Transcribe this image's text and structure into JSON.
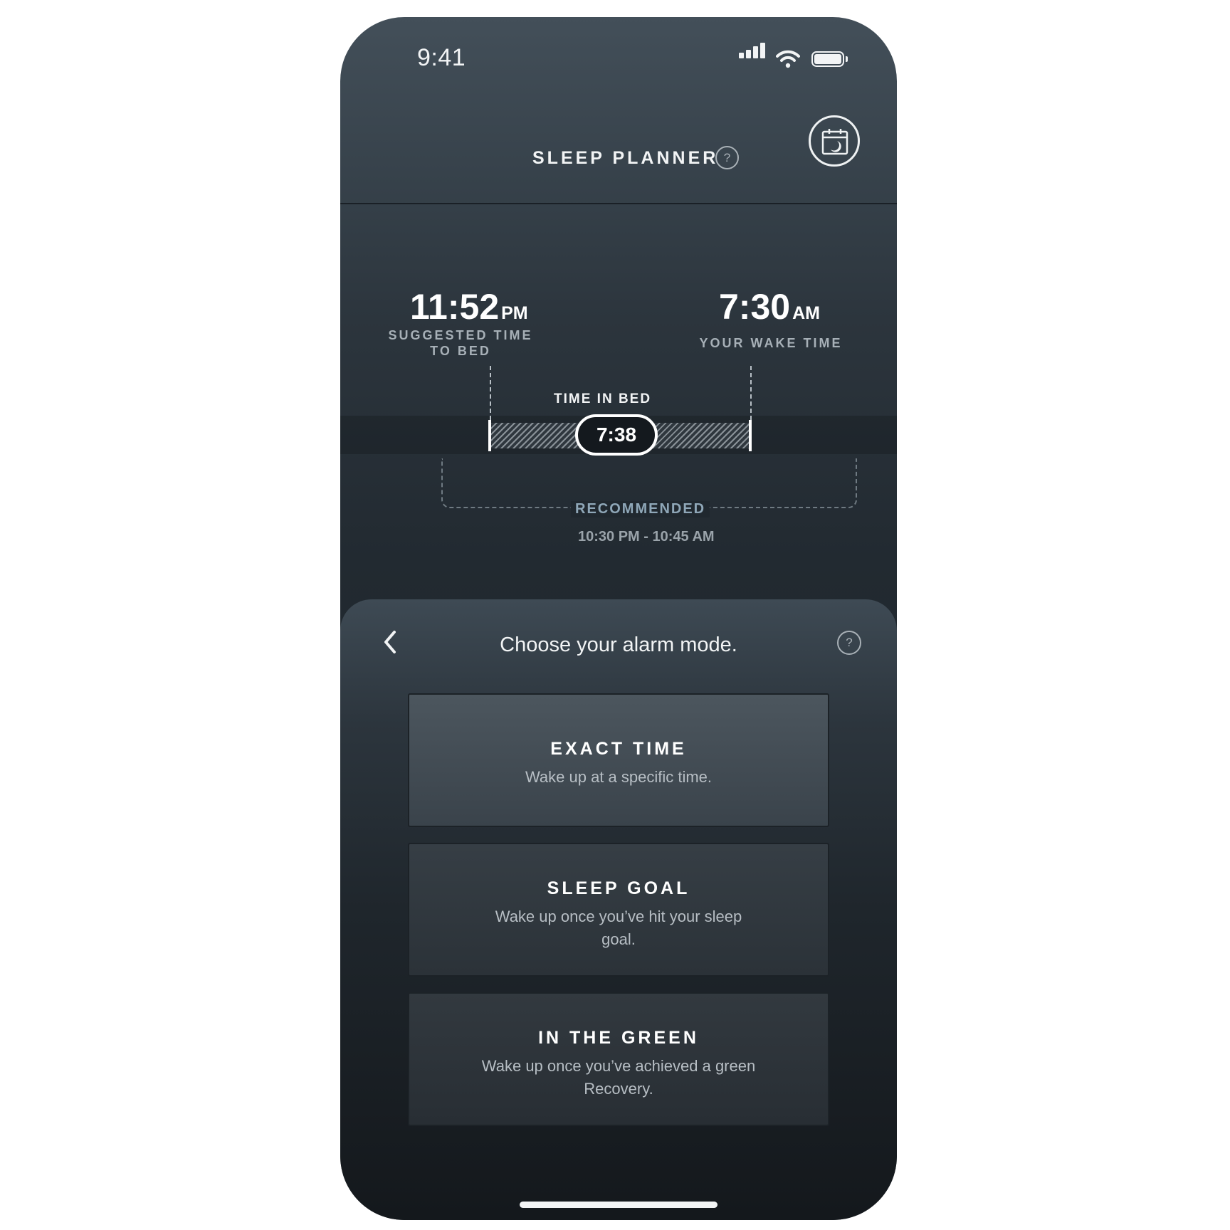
{
  "status_bar": {
    "time": "9:41"
  },
  "header": {
    "title": "SLEEP PLANNER",
    "help_glyph": "?"
  },
  "planner": {
    "bed_time": {
      "value": "11:52",
      "suffix": "PM",
      "label_line1": "SUGGESTED TIME",
      "label_line2": "TO BED"
    },
    "wake_time": {
      "value": "7:30",
      "suffix": "AM",
      "label": "YOUR WAKE TIME"
    },
    "time_in_bed": {
      "label": "TIME IN BED",
      "value": "7:38"
    },
    "recommended": {
      "label": "RECOMMENDED",
      "range": "10:30 PM - 10:45 AM"
    }
  },
  "sheet": {
    "title": "Choose your alarm mode.",
    "help_glyph": "?",
    "options": [
      {
        "title": "EXACT TIME",
        "description": "Wake up at a specific time."
      },
      {
        "title": "SLEEP GOAL",
        "description": "Wake up once you’ve hit your sleep goal."
      },
      {
        "title": "IN THE GREEN",
        "description": "Wake up once you’ve achieved a green Recovery."
      }
    ]
  },
  "icons": {
    "signal": "signal-icon",
    "wifi": "wifi-icon",
    "battery": "battery-icon",
    "calendar": "calendar-moon-icon",
    "back": "chevron-left-icon",
    "help": "question-icon"
  },
  "colors": {
    "accent_recommended": "#8fa7b8",
    "text_primary": "#f2f4f5"
  }
}
